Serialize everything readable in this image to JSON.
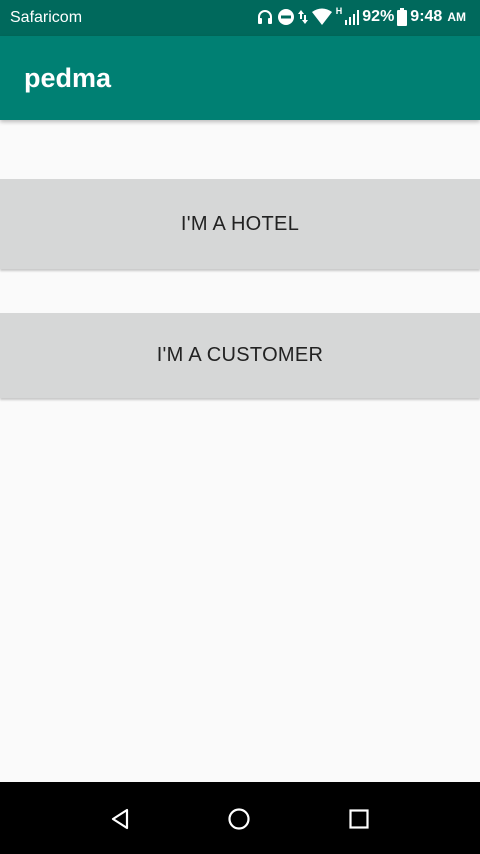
{
  "status_bar": {
    "carrier": "Safaricom",
    "battery": "92%",
    "time": "9:48",
    "ampm": "AM",
    "network": "H"
  },
  "app_bar": {
    "title": "pedma"
  },
  "buttons": {
    "hotel": "I'M A HOTEL",
    "customer": "I'M A CUSTOMER"
  }
}
